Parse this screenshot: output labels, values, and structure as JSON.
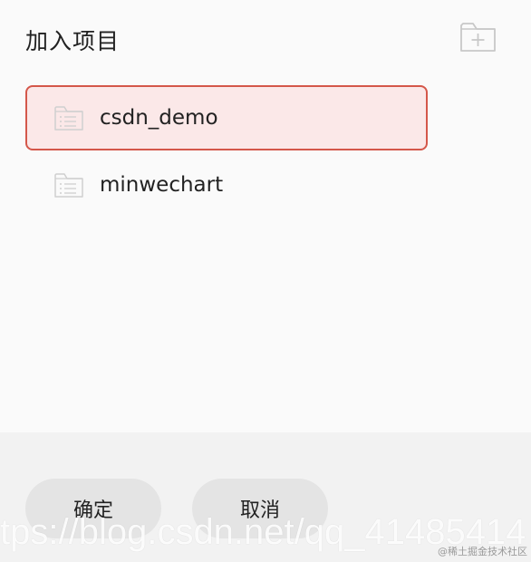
{
  "dialog": {
    "title": "加入项目"
  },
  "toolbar": {
    "new_folder_icon": "folder-add-icon"
  },
  "projects": [
    {
      "label": "csdn_demo",
      "selected": true,
      "icon": "folder-list-icon"
    },
    {
      "label": "minwechart",
      "selected": false,
      "icon": "folder-list-icon"
    }
  ],
  "footer": {
    "confirm_label": "确定",
    "cancel_label": "取消"
  },
  "watermark": {
    "url": "tps://blog.csdn.net/qq_41485414",
    "credit": "@稀土掘金技术社区"
  },
  "colors": {
    "selected_bg": "#fbe8e8",
    "selected_border": "#d4574a",
    "button_bg": "#e4e4e4"
  }
}
